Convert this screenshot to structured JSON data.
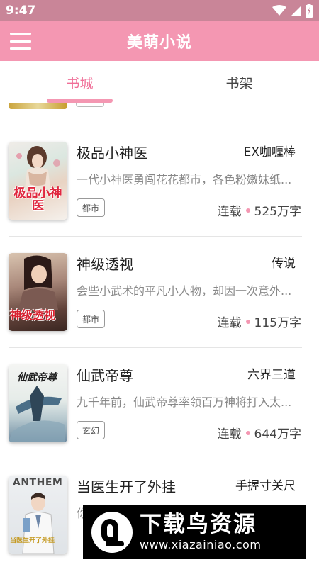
{
  "status_bar": {
    "time": "9:47",
    "icons": [
      "settings-gear-icon",
      "wifi-icon",
      "signal-icon",
      "battery-icon"
    ]
  },
  "app_bar": {
    "title": "美萌小说",
    "menu_icon": "hamburger-menu-icon"
  },
  "tabs": [
    {
      "label": "书城",
      "active": true
    },
    {
      "label": "书架",
      "active": false
    }
  ],
  "books": [
    {
      "title": "极品小神医",
      "author": "EX咖喱棒",
      "description": "一代小神医勇闯花花都市，各色粉嫩妹纸...",
      "genre": "都市",
      "status": "连载",
      "word_count": "525万字",
      "cover_text": "极品小神医"
    },
    {
      "title": "神级透视",
      "author": "传说",
      "description": "会些小武术的平凡小人物，却因一次意外...",
      "genre": "都市",
      "status": "连载",
      "word_count": "115万字",
      "cover_text": "神级透视"
    },
    {
      "title": "仙武帝尊",
      "author": "六界三道",
      "description": "九千年前，仙武帝尊率领百万神将打入太...",
      "genre": "玄幻",
      "status": "连载",
      "word_count": "644万字",
      "cover_text": "仙武帝尊"
    },
    {
      "title": "当医生开了外挂",
      "author": "手握寸关尺",
      "description": "你",
      "genre": "",
      "status": "",
      "word_count": "",
      "cover_text": "ANTHEM",
      "cover_subtext": "当医生开了外挂"
    }
  ],
  "watermark": {
    "name": "下载鸟资源",
    "url": "www.xiazainiao.com"
  },
  "colors": {
    "accent": "#f497b2",
    "status_bar": "#c98598",
    "tab_active": "#f06f98"
  }
}
